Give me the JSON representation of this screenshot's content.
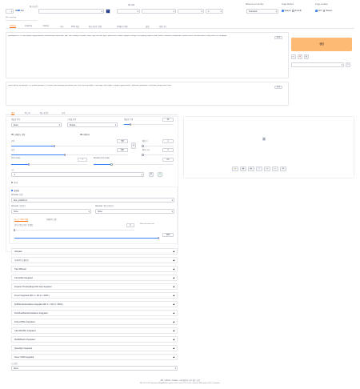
{
  "top": {
    "checkpoint_label": "체크포인트",
    "checkpoint_value": "",
    "vae_label": "SD VAE",
    "refresh_icon": "refresh-icon",
    "clip_label": "CLIP 레이어 건너뛰기",
    "clip_value": "2",
    "lora_label": "",
    "lora_value": "",
    "sampler_label": "",
    "sampler_value": "",
    "extra_label": "",
    "vae_value": "",
    "vae2_value": "",
    "vae3_value": "",
    "precision_label": "Difference in Low Res",
    "precision_value": "Automatic",
    "mode_label": "Image Medium",
    "mode_options": [
      "Sharper",
      "Smooth"
    ],
    "device_label": "Image Location",
    "device_options": [
      "CPU",
      "Shared"
    ],
    "top_tabs": [
      "txt2img",
      "img2img"
    ],
    "version_label": "SD1 img2img"
  },
  "main_tabs": [
    "txt2img",
    "img2img",
    "Extras",
    "기타",
    "PNG 정보",
    "체크포인트 병합",
    "임베딩 트레인",
    "설정",
    "확장 기능"
  ],
  "prompt": {
    "count": "0/75",
    "text": "(masterpiece:1.2), best quality, highly detailed, ultra-detailed, illustration, 1girl, solo, looking at viewer, smile, long hair, blue eyes, white dress, flowers, garden, sunlight, soft lighting, depth of field, bokeh, cinematic composition, vibrant colors, intricate details, sharp focus, 8k, wallpaper",
    "neg_count": "0/75",
    "neg_text": "(worst quality, low quality:1.4), (normal quality:1.2), lowres, bad anatomy, bad hands, text, error, missing fingers, extra digit, fewer digits, cropped, jpeg artifacts, signature, watermark, username, blurry, artist name"
  },
  "generate_label": "생성",
  "tool_icons": [
    "arrow-icon",
    "trash-icon",
    "clipboard-icon"
  ],
  "style_label": "",
  "style_value": "",
  "sub_tabs": [
    "생성",
    "텍스처",
    "체크포인트",
    "로라"
  ],
  "params": {
    "sampler_label": "샘플링 방식",
    "sampler_value": "Euler",
    "schedule_label": "스케줄 유형",
    "schedule_value": "Simple",
    "steps_label": "샘플링 단계",
    "steps_value": "20",
    "steps_frac": 0.13,
    "hires_label": "고해상도 보정",
    "refiner_label": "리파이너",
    "width_label": "너비",
    "width_value": "768",
    "width_frac": 0.37,
    "height_label": "높이",
    "height_value": "960",
    "height_frac": 0.46,
    "batch_count_label": "배치 수",
    "batch_count_value": "1",
    "batch_size_label": "배치 크기",
    "batch_size_value": "1",
    "cfg_label": "CFG Scale",
    "cfg_value": "7",
    "cfg_frac": 0.23,
    "dist_label": "Distilled CFG Scale",
    "dist_value": "3.5",
    "seed_label": "시드",
    "seed_value": "-1",
    "extra_label": "추가",
    "seed_icons": [
      "dice-icon",
      "recycle-icon"
    ]
  },
  "adetailer": {
    "label": "ADetailer",
    "enable_label": "활성화",
    "tabs": [
      "1번째",
      "2번째"
    ],
    "model_label": "ADetailer 모델",
    "model_value": "face_yolov8n.pt",
    "prompt_label": "ADetailer 프롬프트",
    "neg_label": "ADetailer 부정 프롬프트",
    "detect_label": "감지",
    "mask_label": "마스크 전처리",
    "inpaint_label": "인페인팅",
    "conf_label": "감지 모델 신뢰도 임계값",
    "conf_value": "0.3",
    "conf_frac": 0.3,
    "cond_label": "Mask min area ratio",
    "cond_value": "0",
    "mask_value": "1",
    "mask_frac": 1,
    "scheduler_label": "스케줄러",
    "scheduler_value": "None",
    "inpaint_value": "None",
    "sub_tabs": [
      "마스크 전처리 설정",
      "인페인팅 설정"
    ],
    "denoise_label": "노이즈 제거 강도",
    "denoise_value": "0",
    "denoise_frac": 0,
    "unit_value": "1024"
  },
  "accordions": [
    "ADetailer",
    "다이나믹 프롬프트",
    "Tiled Diffusion",
    "ControlNet Integrated",
    "Dynamic Thresholding (CFG Fix) Integrated",
    "FreeU Integrated (SD 1.x, SD 2.x, SDXL)",
    "SelfAttentionGuidance Integrated (SD 1.x, SD 2.x, SDXL)",
    "PerturbedAttentionGuidance Integrated",
    "Kohya HRFix Integrated",
    "LatentModifier Integrated",
    "MultiDiffusion Integrated",
    "StyleAlign Integrated",
    "Never OOM Integrated"
  ],
  "script_label": "스크립트",
  "script_value": "None",
  "output_icons": [
    "folder-icon",
    "image-icon",
    "palette-icon",
    "brush-icon",
    "frame-icon",
    "sparkle-icon",
    "ruler-icon"
  ],
  "placeholder_icon": "image-placeholder-icon",
  "footer": {
    "links": [
      "API",
      "Github",
      "Gradio",
      "시작 페이지",
      "UI 새로 고침"
    ],
    "version": "버전: f2.0.1v1.10.1-previous-636-gb835f24a • python: 3.10.6 • torch: 2.3.1+cu121 • xformers: N/A • gradio: 4.40.0 • checkpoint: "
  },
  "colors": {
    "accent": "#f97316",
    "generate_bg": "#fdba74",
    "primary": "#3b82f6"
  }
}
